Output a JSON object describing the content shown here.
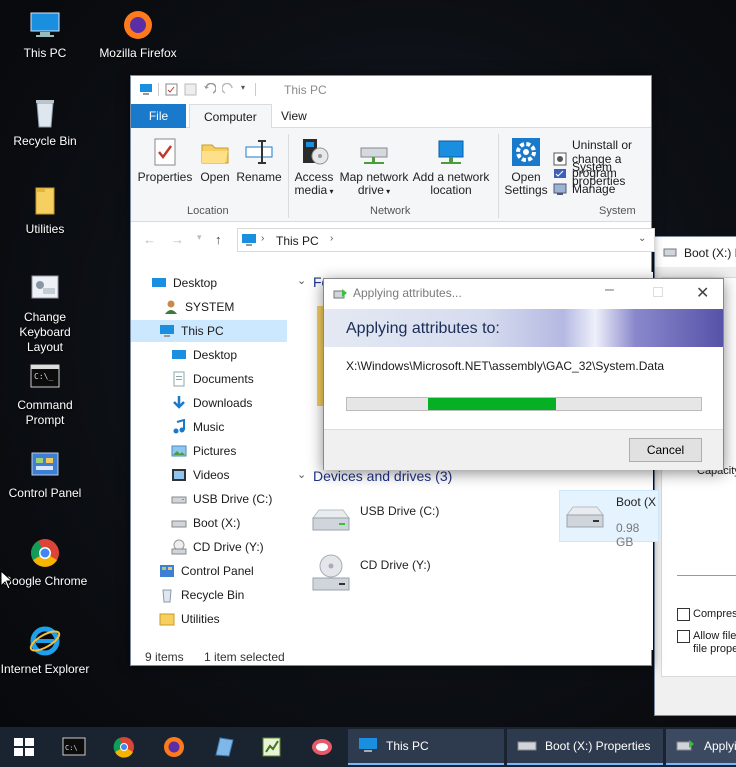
{
  "desktop": {
    "icons": [
      {
        "label": "This PC",
        "icon": "this-pc-icon"
      },
      {
        "label": "Mozilla Firefox",
        "icon": "firefox-icon"
      },
      {
        "label": "Recycle Bin",
        "icon": "recycle-bin-icon"
      },
      {
        "label": "Utilities",
        "icon": "folder-icon"
      },
      {
        "label": "Change Keyboard Layout",
        "icon": "keyboard-layout-icon"
      },
      {
        "label": "Command Prompt",
        "icon": "command-prompt-icon"
      },
      {
        "label": "Control Panel",
        "icon": "control-panel-icon"
      },
      {
        "label": "Google Chrome",
        "icon": "chrome-icon"
      },
      {
        "label": "Internet Explorer",
        "icon": "internet-explorer-icon"
      }
    ]
  },
  "explorer": {
    "title": "This PC",
    "tabs": {
      "file": "File",
      "computer": "Computer",
      "view": "View"
    },
    "ribbon": {
      "properties": "Properties",
      "open": "Open",
      "rename": "Rename",
      "access_media": "Access media",
      "map_network_drive": "Map network drive",
      "add_network_location": "Add a network location",
      "open_settings": "Open Settings",
      "uninstall": "Uninstall or change a program",
      "system_properties": "System properties",
      "manage": "Manage",
      "group_location": "Location",
      "group_network": "Network",
      "group_system": "System"
    },
    "address": {
      "path": "This PC"
    },
    "nav": [
      {
        "label": "Desktop",
        "icon": "desktop-icon"
      },
      {
        "label": "SYSTEM",
        "icon": "user-icon"
      },
      {
        "label": "This PC",
        "icon": "this-pc-icon",
        "selected": true
      },
      {
        "label": "Desktop",
        "icon": "desktop-icon"
      },
      {
        "label": "Documents",
        "icon": "documents-icon"
      },
      {
        "label": "Downloads",
        "icon": "downloads-icon"
      },
      {
        "label": "Music",
        "icon": "music-icon"
      },
      {
        "label": "Pictures",
        "icon": "pictures-icon"
      },
      {
        "label": "Videos",
        "icon": "videos-icon"
      },
      {
        "label": "USB Drive (C:)",
        "icon": "usb-drive-icon"
      },
      {
        "label": "Boot (X:)",
        "icon": "drive-icon"
      },
      {
        "label": "CD Drive (Y:)",
        "icon": "cd-drive-icon"
      },
      {
        "label": "Control Panel",
        "icon": "control-panel-icon"
      },
      {
        "label": "Recycle Bin",
        "icon": "recycle-bin-icon"
      },
      {
        "label": "Utilities",
        "icon": "folder-icon"
      }
    ],
    "content": {
      "folders_header": "Fo",
      "devices_header": "Devices and drives (3)",
      "drives": [
        {
          "label": "USB Drive (C:)"
        },
        {
          "label": "Boot (X",
          "size": "0.98 GB"
        },
        {
          "label": "CD Drive (Y:)"
        }
      ]
    },
    "status": {
      "items": "9 items",
      "selected": "1 item selected"
    }
  },
  "props_window": {
    "title": "Boot (X:) P",
    "compress": "Compress",
    "allow_files": "Allow files",
    "file_prop": "file proper",
    "capacity": "Capacity"
  },
  "dialog": {
    "title": "Applying attributes...",
    "heading": "Applying attributes to:",
    "path": "X:\\Windows\\Microsoft.NET\\assembly\\GAC_32\\System.Data",
    "progress_start": 0.23,
    "progress_end": 0.59,
    "cancel": "Cancel"
  },
  "taskbar": {
    "buttons": [
      {
        "label": "This PC"
      },
      {
        "label": "Boot (X:) Properties"
      },
      {
        "label": "Applyi"
      }
    ]
  },
  "colors": {
    "accent": "#1979ca",
    "progress": "#06b025",
    "taskbar": "#1a2330",
    "selection": "#cce8ff"
  }
}
